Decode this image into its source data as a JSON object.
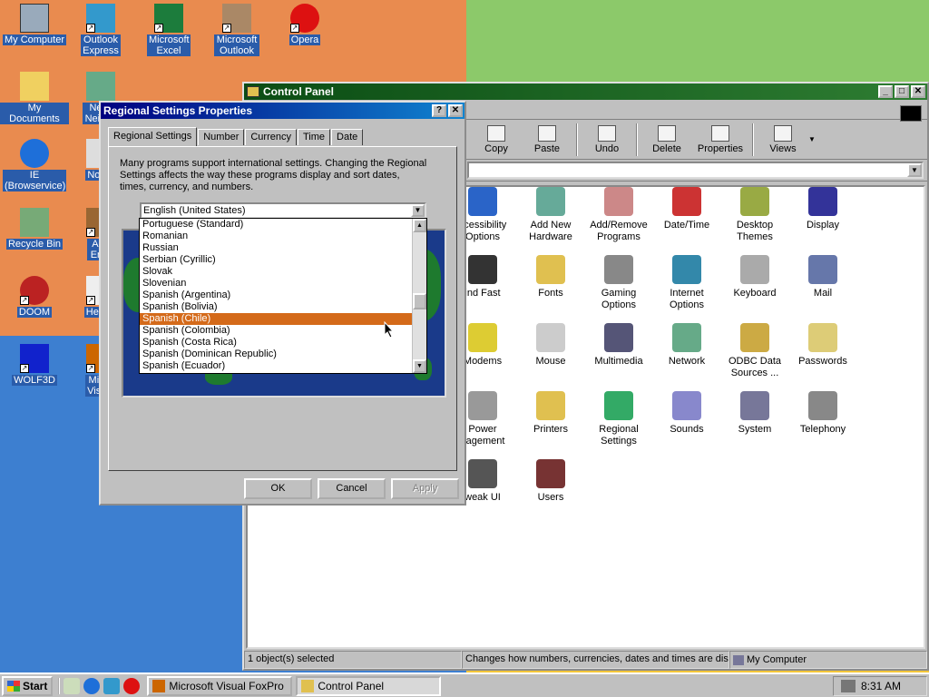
{
  "desktop": {
    "icons": [
      {
        "label": "My Computer",
        "icon": "my-computer-icon",
        "color": "#9ab"
      },
      {
        "label": "Outlook Express",
        "icon": "outlook-express-icon",
        "color": "#39c"
      },
      {
        "label": "Microsoft Excel",
        "icon": "excel-icon",
        "color": "#1c7c3c"
      },
      {
        "label": "Microsoft Outlook",
        "icon": "outlook-icon",
        "color": "#a86"
      },
      {
        "label": "Opera",
        "icon": "opera-icon",
        "color": "#d11"
      },
      {
        "label": "My Documents",
        "icon": "folder-icon",
        "color": "#f0d060"
      },
      {
        "label": "Netw Neighb",
        "icon": "network-icon",
        "color": "#6a8"
      },
      {
        "label": "IE (Browservice)",
        "icon": "internet-explorer-icon",
        "color": "#1e6fd9"
      },
      {
        "label": "Notep",
        "icon": "notepad-icon",
        "color": "#ddd"
      },
      {
        "label": "Recycle Bin",
        "icon": "recycle-bin-icon",
        "color": "#7a7"
      },
      {
        "label": "Age Emp",
        "icon": "game-icon",
        "color": "#963"
      },
      {
        "label": "DOOM",
        "icon": "doom-icon",
        "color": "#b22"
      },
      {
        "label": "Hearts",
        "icon": "hearts-icon",
        "color": "#eee"
      },
      {
        "label": "WOLF3D",
        "icon": "wolf3d-icon",
        "color": "#12c"
      },
      {
        "label": "Micro Visual",
        "icon": "visual-foxpro-icon",
        "color": "#c60"
      }
    ]
  },
  "control_panel": {
    "title": "Control Panel",
    "toolbar": [
      {
        "label": "Copy",
        "icon": "copy-icon"
      },
      {
        "label": "Paste",
        "icon": "paste-icon"
      },
      {
        "label": "Undo",
        "icon": "undo-icon"
      },
      {
        "label": "Delete",
        "icon": "delete-icon"
      },
      {
        "label": "Properties",
        "icon": "properties-icon"
      },
      {
        "label": "Views",
        "icon": "views-icon"
      }
    ],
    "items": [
      {
        "label": "ccessibility Options",
        "icon": "accessibility-icon",
        "color": "#2a64c8"
      },
      {
        "label": "Add New Hardware",
        "icon": "hardware-icon",
        "color": "#6a9"
      },
      {
        "label": "Add/Remove Programs",
        "icon": "add-remove-icon",
        "color": "#c88"
      },
      {
        "label": "Date/Time",
        "icon": "clock-icon",
        "color": "#c33"
      },
      {
        "label": "Desktop Themes",
        "icon": "themes-icon",
        "color": "#9a4"
      },
      {
        "label": "Display",
        "icon": "display-icon",
        "color": "#339"
      },
      {
        "label": "ind Fast",
        "icon": "binoculars-icon",
        "color": "#333"
      },
      {
        "label": "Fonts",
        "icon": "fonts-icon",
        "color": "#e0c050"
      },
      {
        "label": "Gaming Options",
        "icon": "joystick-icon",
        "color": "#888"
      },
      {
        "label": "Internet Options",
        "icon": "globe-icon",
        "color": "#38a"
      },
      {
        "label": "Keyboard",
        "icon": "keyboard-icon",
        "color": "#aaa"
      },
      {
        "label": "Mail",
        "icon": "mail-icon",
        "color": "#67a"
      },
      {
        "label": "Modems",
        "icon": "modem-icon",
        "color": "#dc3"
      },
      {
        "label": "Mouse",
        "icon": "mouse-icon",
        "color": "#ccc"
      },
      {
        "label": "Multimedia",
        "icon": "multimedia-icon",
        "color": "#557"
      },
      {
        "label": "Network",
        "icon": "network-icon",
        "color": "#6a8"
      },
      {
        "label": "ODBC Data Sources ...",
        "icon": "odbc-icon",
        "color": "#ca4"
      },
      {
        "label": "Passwords",
        "icon": "keys-icon",
        "color": "#dc7"
      },
      {
        "label": "Power nagement",
        "icon": "power-icon",
        "color": "#999"
      },
      {
        "label": "Printers",
        "icon": "printer-folder-icon",
        "color": "#e0c050"
      },
      {
        "label": "Regional Settings",
        "icon": "globe-icon",
        "color": "#3a6"
      },
      {
        "label": "Sounds",
        "icon": "speaker-icon",
        "color": "#88c"
      },
      {
        "label": "System",
        "icon": "computer-icon",
        "color": "#779"
      },
      {
        "label": "Telephony",
        "icon": "telephone-icon",
        "color": "#888"
      },
      {
        "label": "weak UI",
        "icon": "tweak-ui-icon",
        "color": "#555"
      },
      {
        "label": "Users",
        "icon": "users-icon",
        "color": "#733"
      }
    ],
    "status": {
      "selected": "1 object(s) selected",
      "description": "Changes how numbers, currencies, dates and times are disp",
      "location": "My Computer"
    }
  },
  "regional_dialog": {
    "title": "Regional Settings Properties",
    "help_button": "?",
    "close_button": "✕",
    "tabs": [
      "Regional Settings",
      "Number",
      "Currency",
      "Time",
      "Date"
    ],
    "description": "Many programs support international settings. Changing the Regional Settings affects the way these programs display and sort dates, times, currency, and numbers.",
    "selected_locale": "English (United States)",
    "dropdown_options": [
      "Portuguese (Standard)",
      "Romanian",
      "Russian",
      "Serbian (Cyrillic)",
      "Slovak",
      "Slovenian",
      "Spanish (Argentina)",
      "Spanish (Bolivia)",
      "Spanish (Chile)",
      "Spanish (Colombia)",
      "Spanish (Costa Rica)",
      "Spanish (Dominican Republic)",
      "Spanish (Ecuador)"
    ],
    "highlighted_option": "Spanish (Chile)",
    "buttons": {
      "ok": "OK",
      "cancel": "Cancel",
      "apply": "Apply"
    }
  },
  "taskbar": {
    "start_label": "Start",
    "tasks": [
      {
        "label": "Microsoft Visual FoxPro",
        "icon": "visual-foxpro-icon",
        "pressed": false
      },
      {
        "label": "Control Panel",
        "icon": "control-panel-icon",
        "pressed": true
      }
    ],
    "quick_launch": [
      "show-desktop-icon",
      "internet-explorer-icon",
      "outlook-express-icon",
      "opera-icon"
    ],
    "clock": "8:31 AM"
  }
}
